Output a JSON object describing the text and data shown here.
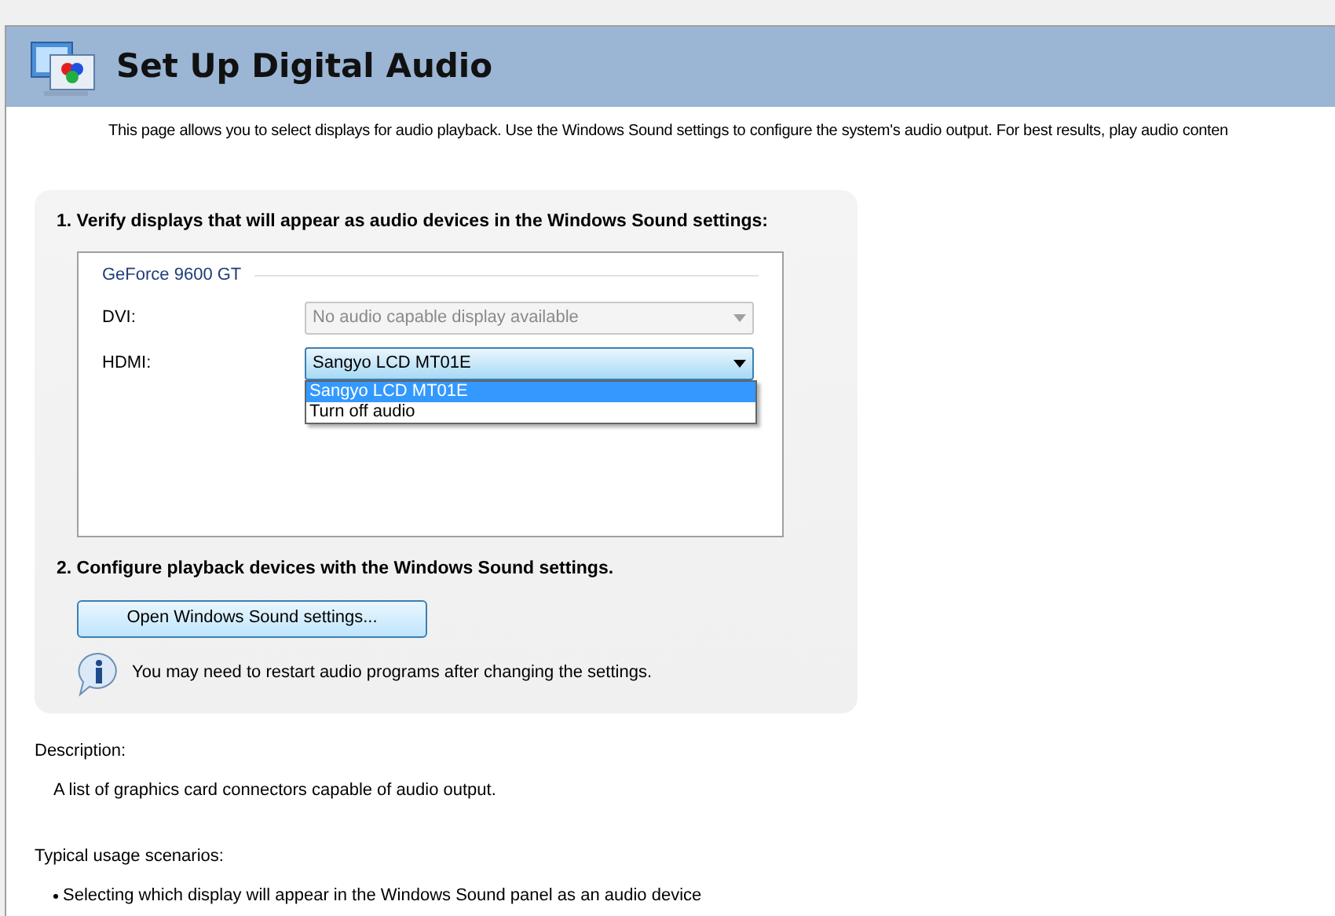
{
  "header": {
    "title": "Set Up Digital Audio"
  },
  "intro": "This page allows you to select displays for audio playback. Use the Windows Sound settings to configure the system's audio output. For best results, play audio conten",
  "step1": {
    "heading": "1. Verify displays that will appear as audio devices in the Windows Sound settings:",
    "group": {
      "title": "GeForce 9600 GT",
      "connectors": [
        {
          "label": "DVI:",
          "value": "No audio capable display available",
          "disabled": true,
          "expanded": false
        },
        {
          "label": "HDMI:",
          "value": "Sangyo LCD MT01E",
          "disabled": false,
          "expanded": true,
          "options": [
            {
              "label": "Sangyo LCD MT01E",
              "selected": true
            },
            {
              "label": "Turn off audio",
              "selected": false
            }
          ]
        }
      ]
    }
  },
  "step2": {
    "heading": "2. Configure playback devices with the Windows Sound settings.",
    "button": "Open Windows Sound settings...",
    "note": "You may need to restart audio programs after changing the settings."
  },
  "description": {
    "label": "Description:",
    "text": "A list of graphics card connectors capable of audio output."
  },
  "usage": {
    "label": "Typical usage scenarios:",
    "items": [
      "Selecting which display will appear in the Windows Sound panel as an audio device"
    ]
  }
}
